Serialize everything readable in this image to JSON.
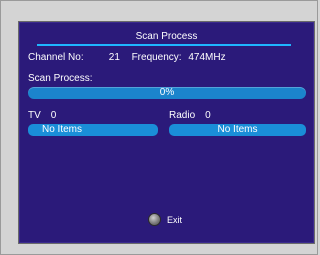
{
  "dialog": {
    "title": "Scan Process",
    "channel_label": "Channel No:",
    "channel_value": "21",
    "frequency_label": "Frequency:",
    "frequency_value": "474MHz",
    "scan_process_label": "Scan Process:",
    "progress": {
      "percent_text": "0%",
      "fraction": 0.0
    },
    "tv": {
      "label": "TV",
      "count": "0",
      "status": "No Items"
    },
    "radio": {
      "label": "Radio",
      "count": "0",
      "status": "No Items"
    },
    "exit_label": "Exit"
  },
  "colors": {
    "panel_bg": "#2b1a7a",
    "accent_line": "#1fb6ff",
    "progress_bar": "#1b84cc",
    "list_box": "#1a8ed8",
    "frame_bg": "#d4d4d4"
  },
  "icons": {
    "exit": "round-button-icon"
  }
}
